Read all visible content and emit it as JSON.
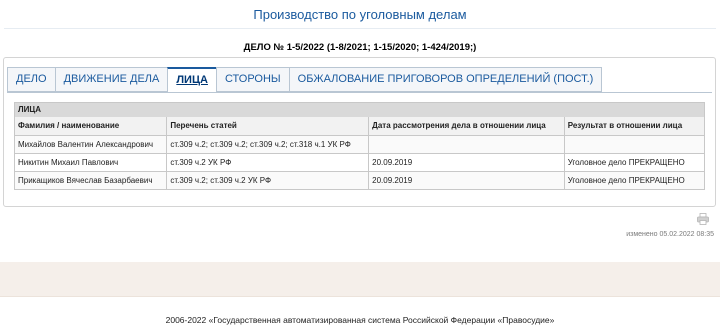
{
  "page_title": "Производство по уголовным делам",
  "case_number": "ДЕЛО № 1-5/2022 (1-8/2021; 1-15/2020; 1-424/2019;)",
  "tabs": [
    {
      "label": "ДЕЛО",
      "active": false
    },
    {
      "label": "ДВИЖЕНИЕ ДЕЛА",
      "active": false
    },
    {
      "label": "ЛИЦА",
      "active": true
    },
    {
      "label": "СТОРОНЫ",
      "active": false
    },
    {
      "label": "ОБЖАЛОВАНИЕ ПРИГОВОРОВ ОПРЕДЕЛЕНИЙ (ПОСТ.)",
      "active": false
    }
  ],
  "persons": {
    "caption": "ЛИЦА",
    "columns": [
      "Фамилия / наименование",
      "Перечень статей",
      "Дата рассмотрения дела в отношении лица",
      "Результат в отношении лица"
    ],
    "rows": [
      [
        "Михайлов Валентин Александрович",
        "ст.309 ч.2; ст.309 ч.2; ст.309 ч.2; ст.318 ч.1 УК РФ",
        "",
        ""
      ],
      [
        "Никитин Михаил Павлович",
        "ст.309 ч.2 УК РФ",
        "20.09.2019",
        "Уголовное дело ПРЕКРАЩЕНО"
      ],
      [
        "Прикащиков Вячеслав Базарбаевич",
        "ст.309 ч.2; ст.309 ч.2 УК РФ",
        "20.09.2019",
        "Уголовное дело ПРЕКРАЩЕНО"
      ]
    ]
  },
  "modified": "изменено 05.02.2022 08:35",
  "footer": "2006-2022 «Государственная автоматизированная система Российской Федерации «Правосудие»",
  "icons": {
    "print": "printer-icon"
  },
  "colors": {
    "accent": "#1a5a9e",
    "footer_band": "#f5efea"
  }
}
